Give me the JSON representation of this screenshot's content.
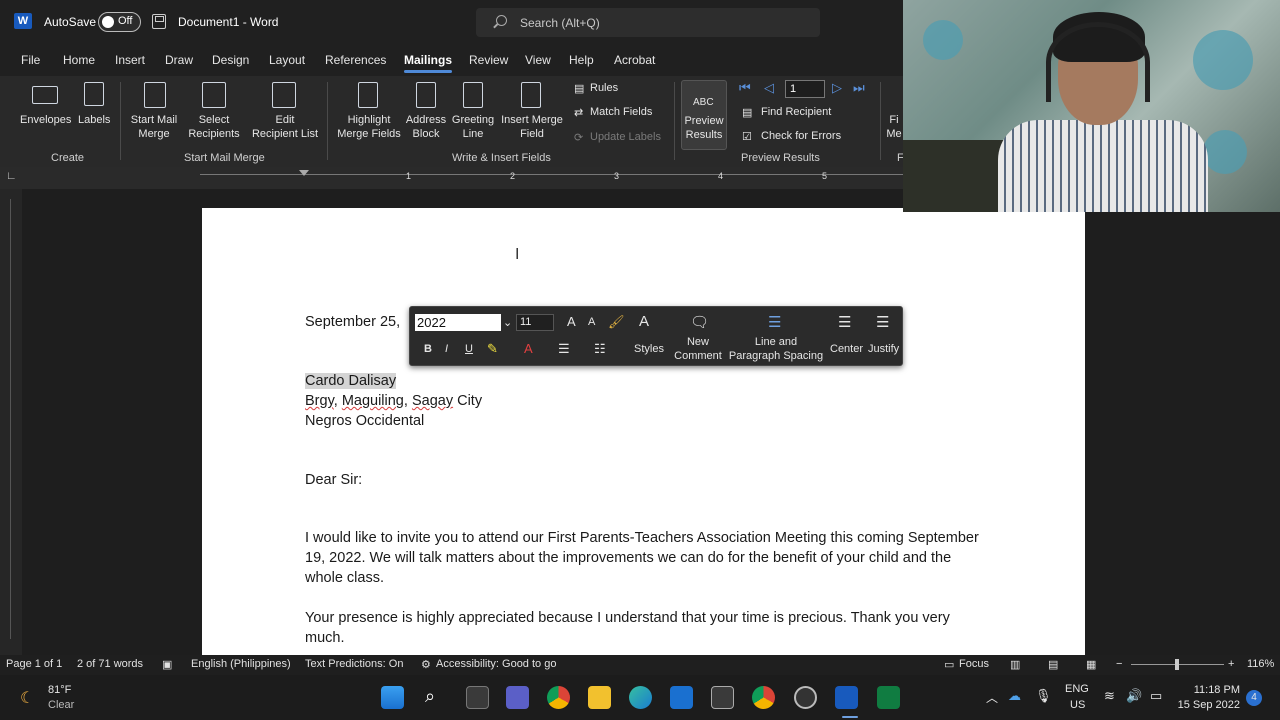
{
  "title_bar": {
    "autosave_label": "AutoSave",
    "autosave_state": "Off",
    "document_title": "Document1 - Word",
    "search_placeholder": "Search (Alt+Q)"
  },
  "menu_tabs": [
    "File",
    "Home",
    "Insert",
    "Draw",
    "Design",
    "Layout",
    "References",
    "Mailings",
    "Review",
    "View",
    "Help",
    "Acrobat"
  ],
  "active_tab": "Mailings",
  "ribbon": {
    "envelopes": "Envelopes",
    "labels": "Labels",
    "start_mail_merge": [
      "Start Mail",
      "Merge"
    ],
    "select_recipients": [
      "Select",
      "Recipients"
    ],
    "edit_recipient_list": [
      "Edit",
      "Recipient List"
    ],
    "highlight_merge_fields": [
      "Highlight",
      "Merge Fields"
    ],
    "address_block": [
      "Address",
      "Block"
    ],
    "greeting_line": [
      "Greeting",
      "Line"
    ],
    "insert_merge_field": [
      "Insert Merge",
      "Field"
    ],
    "rules": "Rules",
    "match_fields": "Match Fields",
    "update_labels": "Update Labels",
    "preview_results": [
      "Preview",
      "Results"
    ],
    "preview_abc": "ABC",
    "record_number": "1",
    "find_recipient": "Find Recipient",
    "check_for_errors": "Check for Errors",
    "finish_partial": [
      "Fi",
      "Me"
    ],
    "group_create": "Create",
    "group_start_mail_merge": "Start Mail Merge",
    "group_write_insert": "Write & Insert Fields",
    "group_preview_results": "Preview Results",
    "group_finish_partial": "F"
  },
  "ruler": {
    "numbers": [
      "1",
      "2",
      "3",
      "4",
      "5"
    ]
  },
  "mini_toolbar": {
    "font_value": "2022",
    "font_size": "11",
    "bold": "B",
    "italic": "I",
    "underline": "U",
    "styles": "Styles",
    "new_comment": [
      "New",
      "Comment"
    ],
    "line_spacing": [
      "Line and",
      "Paragraph Spacing"
    ],
    "center": "Center",
    "justify": "Justify"
  },
  "document": {
    "date_line": "September 25,",
    "name": "Cardo Dalisay",
    "address": {
      "brgy": "Brgy",
      "maguiling": "Maguiling",
      "sagay": "Sagay",
      "city": "City"
    },
    "province": "Negros Occidental",
    "salutation": "Dear Sir:",
    "paragraph1": "I would like to invite you to attend our First Parents-Teachers Association Meeting this coming September 19, 2022. We will talk matters about the improvements we can do for the benefit of your child and the whole class.",
    "paragraph2": "Your presence is highly appreciated because I understand that your time is precious. Thank you very much."
  },
  "status_bar": {
    "page": "Page 1 of 1",
    "words": "2 of 71 words",
    "language": "English (Philippines)",
    "text_predictions": "Text Predictions: On",
    "accessibility": "Accessibility: Good to go",
    "focus": "Focus",
    "zoom": "116%",
    "zoom_fraction": 0.5
  },
  "taskbar": {
    "weather_temp": "81°F",
    "weather_desc": "Clear",
    "lang_top": "ENG",
    "lang_bottom": "US",
    "time": "11:18 PM",
    "date": "15 Sep 2022",
    "notifications": "4"
  },
  "colors": {
    "accent": "#4f8ad8",
    "word_blue": "#185abd",
    "excel_green": "#107c41",
    "selection": "#d4d4d4",
    "spell_error": "#d43b3b"
  },
  "icons": [
    "word-logo-icon",
    "save-icon",
    "search-icon",
    "envelope-icon",
    "labels-icon",
    "start-mail-merge-icon",
    "select-recipients-icon",
    "edit-recipient-list-icon",
    "highlight-fields-icon",
    "address-block-icon",
    "greeting-line-icon",
    "insert-merge-field-icon",
    "rules-icon",
    "match-fields-icon",
    "update-labels-icon",
    "first-record-icon",
    "prev-record-icon",
    "next-record-icon",
    "last-record-icon",
    "find-recipient-icon",
    "check-errors-icon",
    "format-painter-icon",
    "highlight-color-icon",
    "font-color-icon",
    "bullets-icon",
    "numbering-icon",
    "styles-icon",
    "comment-icon",
    "line-spacing-icon",
    "center-align-icon",
    "justify-icon",
    "windows-start-icon",
    "taskbar-search-icon",
    "chrome-icon",
    "explorer-icon",
    "edge-icon",
    "mail-icon",
    "store-icon",
    "word-taskbar-icon",
    "excel-taskbar-icon",
    "wifi-icon",
    "volume-icon",
    "battery-icon",
    "mic-icon",
    "onedrive-icon"
  ]
}
